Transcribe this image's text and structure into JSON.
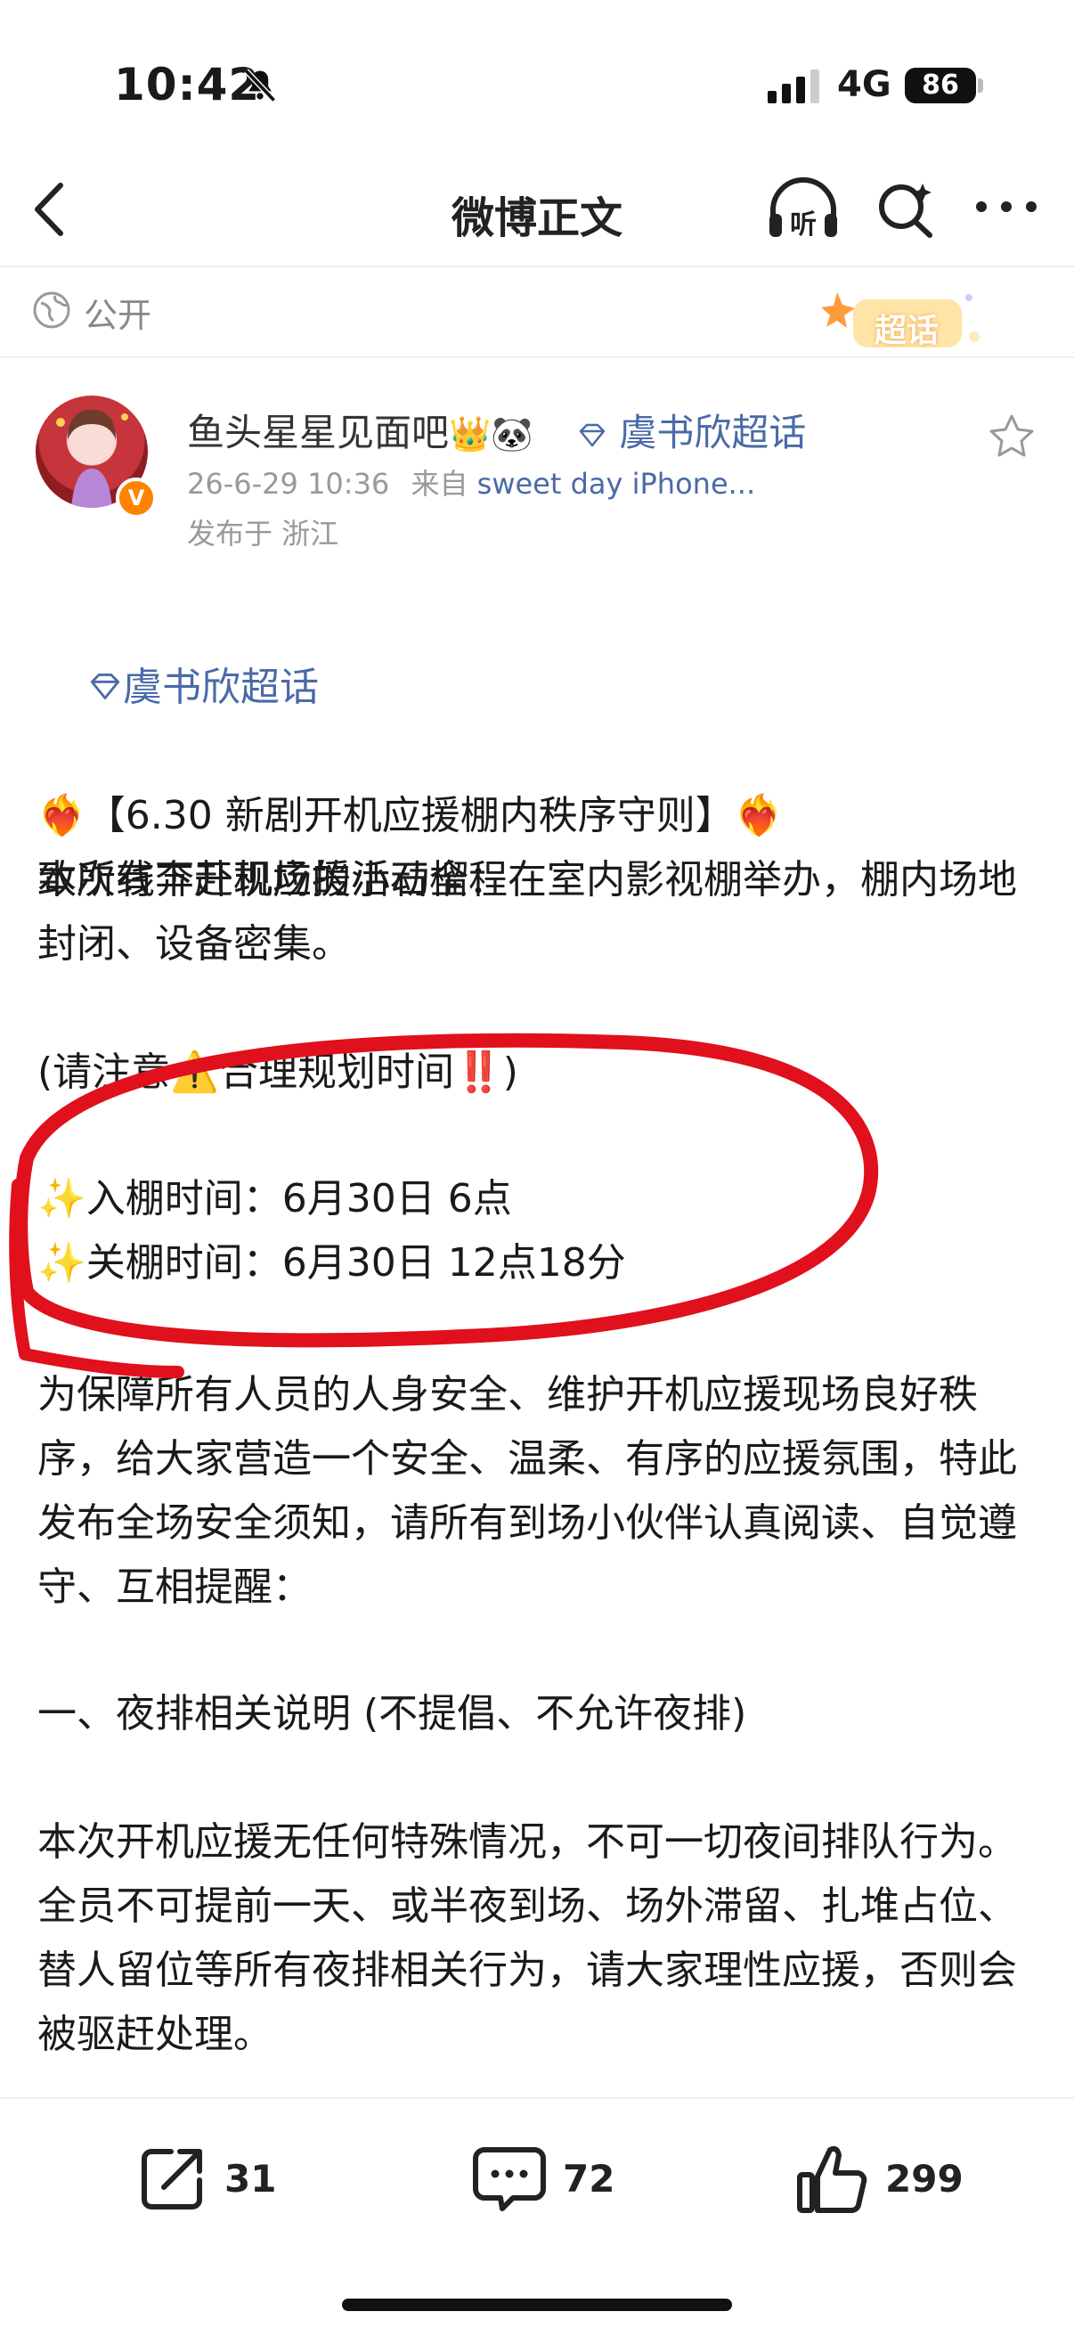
{
  "status_bar": {
    "time": "10:42",
    "network": "4G",
    "battery": "86"
  },
  "nav": {
    "title": "微博正文"
  },
  "visibility": {
    "label": "公开",
    "super_badge": "超话"
  },
  "author": {
    "name": "鱼头星星见面吧",
    "name_emojis": "👑🐼",
    "topic": "虞书欣超话",
    "timestamp": "26-6-29 10:36",
    "source_prefix": "来自",
    "source": "sweet day iPhone...",
    "location": "发布于 浙江"
  },
  "post": {
    "topic_tag": "虞书欣超话",
    "headline": "❤️‍🔥【6.30 新剧开机应援棚内秩序守则】❤️‍🔥",
    "greeting": "致所有奔赴现场的小石榴：",
    "para1": "本次线下开机应援活动全程在室内影视棚举办，棚内场地封闭、设备密集。",
    "notice": "(请注意⚠️合理规划时间‼️)",
    "entry_time": "✨入棚时间：6月30日 6点",
    "close_time": "✨关棚时间：6月30日 12点18分",
    "para2": "为保障所有人员的人身安全、维护开机应援现场良好秩序，给大家营造一个安全、温柔、有序的应援氛围，特此发布全场安全须知，请所有到场小伙伴认真阅读、自觉遵守、互相提醒：",
    "section1_title": "一、夜排相关说明 (不提倡、不允许夜排)",
    "para3": "本次开机应援无任何特殊情况，不可一切夜间排队行为。全员不可提前一天、或半夜到场、场外滞留、扎堆占位、替人留位等所有夜排相关行为，请大家理性应援，否则会被驱赶处理。"
  },
  "actions": {
    "repost_count": "31",
    "comment_count": "72",
    "like_count": "299"
  },
  "colors": {
    "link": "#4a6aa8",
    "annotation": "#e0101c",
    "verified": "#ff8200"
  },
  "icons": [
    "bell-muted-icon",
    "back-arrow-icon",
    "listen-icon",
    "search-icon",
    "more-icon",
    "globe-icon",
    "star-icon",
    "repost-icon",
    "comment-icon",
    "like-icon"
  ]
}
